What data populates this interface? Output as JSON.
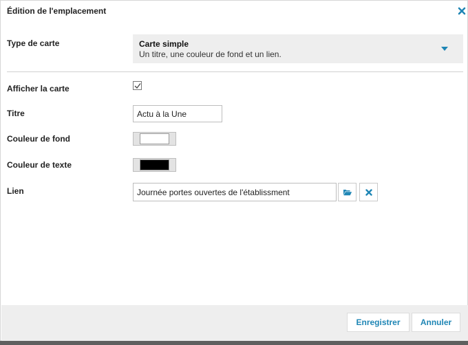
{
  "dialog": {
    "title": "Édition de l'emplacement",
    "close_icon": "close-icon"
  },
  "form": {
    "card_type": {
      "label": "Type de carte",
      "selected_title": "Carte simple",
      "selected_description": "Un titre, une couleur de fond et un lien."
    },
    "show_card": {
      "label": "Afficher la carte",
      "checked": true
    },
    "title_field": {
      "label": "Titre",
      "value": "Actu à la Une"
    },
    "background_color": {
      "label": "Couleur de fond",
      "value": "#ffffff"
    },
    "text_color": {
      "label": "Couleur de texte",
      "value": "#000000"
    },
    "link": {
      "label": "Lien",
      "value": "Journée portes ouvertes de l'établissment",
      "browse_icon": "folder-open-icon",
      "clear_icon": "close-icon"
    }
  },
  "footer": {
    "save_label": "Enregistrer",
    "cancel_label": "Annuler"
  },
  "colors": {
    "accent": "#1f86b5",
    "footer_bg": "#eeeeee",
    "select_bg": "#eeeeee"
  }
}
